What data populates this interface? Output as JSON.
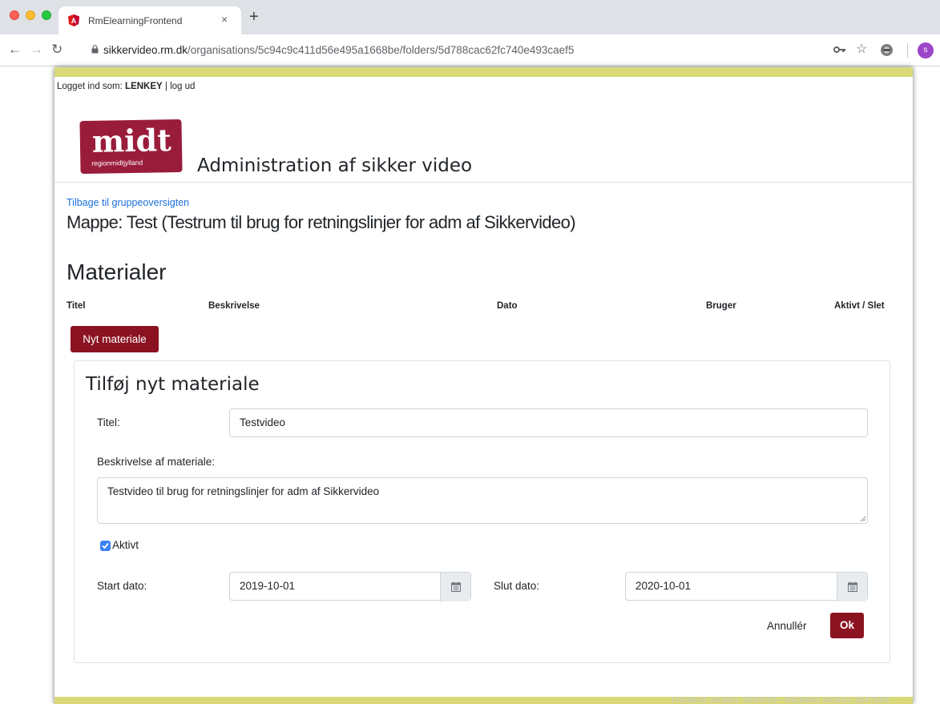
{
  "browser": {
    "tab_title": "RmElearningFrontend",
    "tab_close": "×",
    "new_tab": "+",
    "url_host": "sikkervideo.rm.dk",
    "url_path": "/organisations/5c94c9c411d56e495a1668be/folders/5d788cac62fc740e493caef5",
    "profile_initial": "s",
    "icons": [
      "back-icon",
      "forward-icon",
      "reload-icon",
      "lock-icon",
      "key-icon",
      "star-icon",
      "extension-icon",
      "avatar"
    ]
  },
  "header": {
    "logged_in_prefix": "Logget ind som:",
    "username": "LENKEY",
    "logout_sep": "|",
    "logout": "log ud",
    "logo_main": "midt",
    "logo_sub": "regionmidtjylland",
    "app_title": "Administration af sikker video"
  },
  "main": {
    "back_link": "Tilbage til gruppeoversigten",
    "folder_title": "Mappe: Test (Testrum til brug for retningslinjer for adm af Sikkervideo)",
    "materials_title": "Materialer",
    "columns": [
      "Titel",
      "Beskrivelse",
      "Dato",
      "Bruger",
      "Aktivt / Slet"
    ],
    "new_button": "Nyt materiale"
  },
  "form": {
    "title": "Tilføj nyt materiale",
    "title_label": "Titel:",
    "title_value": "Testvideo",
    "desc_label": "Beskrivelse af materiale:",
    "desc_value": "Testvideo til brug for retningslinjer for adm af Sikkervideo",
    "active_label": "Aktivt",
    "active_checked": true,
    "start_label": "Start dato:",
    "start_value": "2019-10-01",
    "end_label": "Slut dato:",
    "end_value": "2020-10-01",
    "cancel": "Annullér",
    "ok": "Ok"
  },
  "footer": {
    "version_text": "Frontend version: 90d4563 - Backend version: a547bb8"
  },
  "colors": {
    "brand": "#8b1220",
    "logo_bg": "#9a1c3b",
    "accent_bar": "#d9d97a",
    "link": "#1a6ed8"
  }
}
